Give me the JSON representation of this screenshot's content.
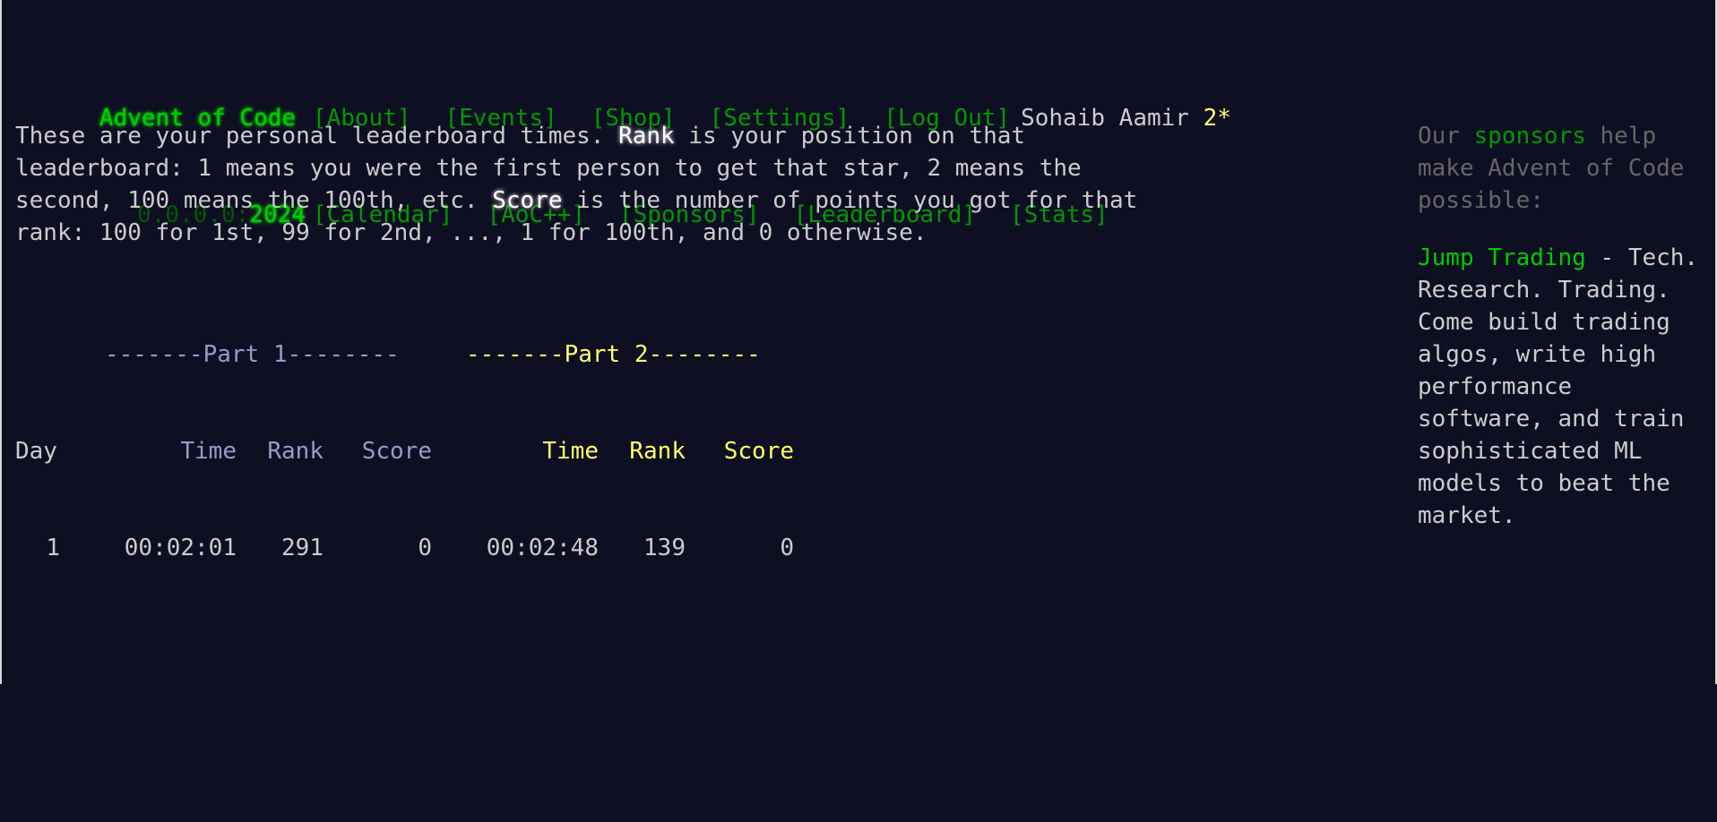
{
  "header": {
    "site_title": "Advent of Code",
    "nav_top": [
      "[About]",
      "[Events]",
      "[Shop]",
      "[Settings]",
      "[Log Out]"
    ],
    "user_name": "Sohaib Aamir",
    "user_stars": "2*",
    "year_prefix": "0.0.0.0:",
    "year": "2024",
    "nav_bottom": [
      "[Calendar]",
      "[AoC++]",
      "[Sponsors]",
      "[Leaderboard]",
      "[Stats]"
    ]
  },
  "intro": {
    "t1": "These are your personal leaderboard times. ",
    "rank_word": "Rank",
    "t2": " is your position on that leaderboard: 1 means you were the first person to get that star, 2 means the second, 100 means the 100th, etc. ",
    "score_word": "Score",
    "t3": " is the number of points you got for that rank: 100 for 1st, 99 for 2nd, ..., 1 for 100th, and 0 otherwise."
  },
  "table": {
    "part1_header": "-------Part 1--------",
    "part2_header": "-------Part 2--------",
    "col_day": "Day",
    "col_time": "Time",
    "col_rank": "Rank",
    "col_score": "Score",
    "rows": [
      {
        "day": "1",
        "p1_time": "00:02:01",
        "p1_rank": "291",
        "p1_score": "0",
        "p2_time": "00:02:48",
        "p2_rank": "139",
        "p2_score": "0"
      }
    ]
  },
  "sidebar": {
    "lead_before": "Our ",
    "lead_link": "sponsors",
    "lead_after": " help make Advent of Code possible:",
    "sponsor_name": "Jump Trading",
    "sponsor_dash": " - ",
    "sponsor_text": "Tech. Research. Trading. Come build trading algos, write high performance software, and train sophisticated ML models to beat the market."
  }
}
